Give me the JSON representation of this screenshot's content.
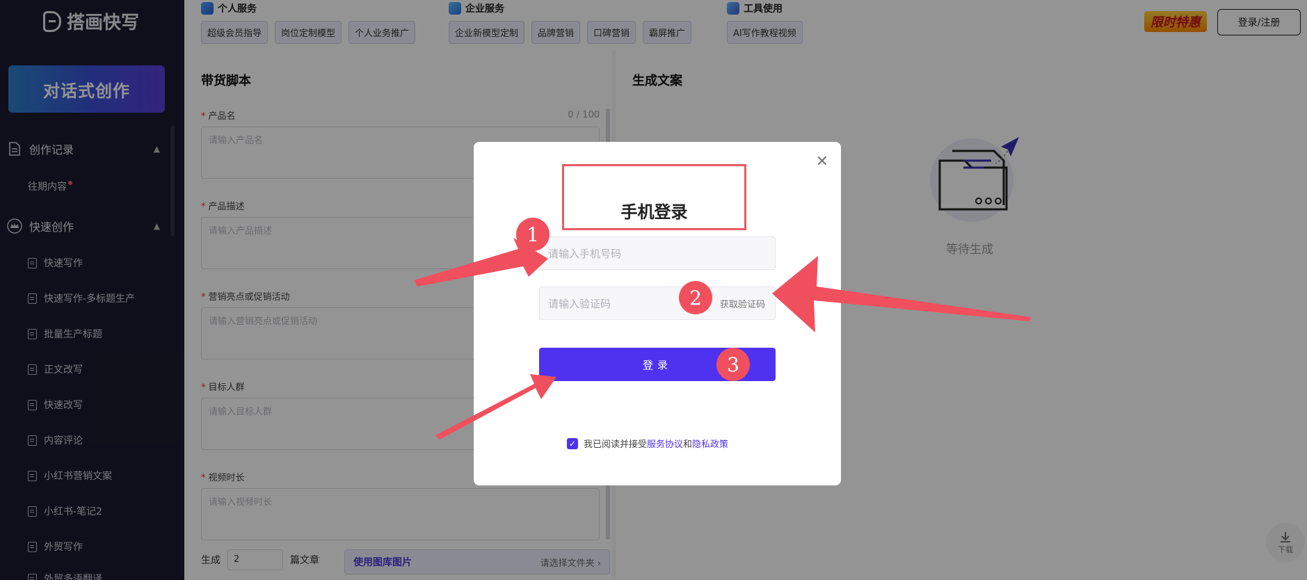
{
  "sidebar": {
    "logo_text": "搭画快写",
    "cta_label": "对话式创作",
    "groups": [
      {
        "label": "创作记录",
        "icon": "document-icon",
        "children": [
          {
            "label": "往期内容"
          }
        ]
      },
      {
        "label": "快速创作",
        "icon": "crown-icon"
      }
    ],
    "nav_items": [
      {
        "label": "快速写作"
      },
      {
        "label": "快速写作-多标题生产"
      },
      {
        "label": "批量生产标题"
      },
      {
        "label": "正文改写"
      },
      {
        "label": "快速改写"
      },
      {
        "label": "内容评论"
      },
      {
        "label": "小红书营销文案"
      },
      {
        "label": "小红书-笔记2"
      },
      {
        "label": "外贸写作"
      },
      {
        "label": "外贸多语翻译"
      }
    ]
  },
  "topbar": {
    "groups": [
      {
        "title": "个人服务",
        "chips": [
          "超级会员指导",
          "岗位定制模型",
          "个人业务推广"
        ]
      },
      {
        "title": "企业服务",
        "chips": [
          "企业新模型定制",
          "品牌营销",
          "口碑营销",
          "霸屏推广"
        ]
      },
      {
        "title": "工具使用",
        "chips": [
          "AI写作教程视频"
        ]
      }
    ],
    "promo_text": "限时特惠",
    "login_label": "登录/注册"
  },
  "form": {
    "title": "带货脚本",
    "counter": "0 / 100",
    "fields": [
      {
        "label": "产品名",
        "placeholder": "请输入产品名"
      },
      {
        "label": "产品描述",
        "placeholder": "请输入产品描述"
      },
      {
        "label": "营销亮点或促销活动",
        "placeholder": "请输入营销亮点或促销活动"
      },
      {
        "label": "目标人群",
        "placeholder": "请输入目标人群"
      },
      {
        "label": "视频时长",
        "placeholder": "请输入视频时长"
      }
    ],
    "generate_prefix": "生成",
    "generate_count": "2",
    "generate_suffix": "篇文章",
    "library_label": "使用图库图片",
    "library_hint": "请选择文件夹"
  },
  "result": {
    "title": "生成文案",
    "waiting_text": "等待生成",
    "download_label": "下载"
  },
  "modal": {
    "title": "手机登录",
    "phone_placeholder": "请输入手机号码",
    "code_placeholder": "请输入验证码",
    "get_code_label": "获取验证码",
    "submit_label": "登录",
    "agree_prefix": "我已阅读并接受",
    "agree_link1": "服务协议",
    "agree_and": "和",
    "agree_link2": "隐私政策",
    "close_icon": "close-icon"
  },
  "annotations": {
    "badges": [
      "1",
      "2",
      "3"
    ],
    "color": "#f0505e"
  },
  "colors": {
    "sidebar_bg": "#1b1b2f",
    "accent": "#4f32f0",
    "annotation": "#f0505e"
  }
}
